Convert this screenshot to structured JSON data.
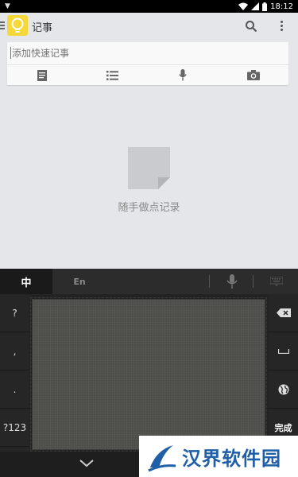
{
  "status_bar": {
    "left_indicator": "▼",
    "time": "18:12",
    "icons": [
      "wifi-icon",
      "signal-icon",
      "battery-icon"
    ]
  },
  "action_bar": {
    "app_title": "记事",
    "icons": [
      "menu-icon",
      "lightbulb-icon",
      "search-icon",
      "overflow-menu-icon"
    ]
  },
  "quick_note": {
    "placeholder": "添加快速记事",
    "buttons": [
      "text-note-icon",
      "checklist-icon",
      "microphone-icon",
      "camera-icon"
    ]
  },
  "empty_state": {
    "icon": "note-page-icon",
    "message": "随手做点记录"
  },
  "keyboard": {
    "tab_chinese": "中",
    "tab_english": "En",
    "left_keys": [
      "?",
      ",",
      ".",
      "?123"
    ],
    "right_keys": [
      "backspace-icon",
      "space-icon",
      "globe-icon",
      "完成"
    ],
    "top_icons": [
      "microphone-icon",
      "keyboard-grid-icon"
    ]
  },
  "nav_bar": {
    "icons": [
      "back-chevron-icon"
    ]
  },
  "watermark": {
    "text": "汉界软件园"
  },
  "colors": {
    "background": "#e4e6e9",
    "card": "#f9f9f9",
    "keyboard": "#232323",
    "accent_yellow": "#f6d838",
    "watermark_blue": "#1f5fa8"
  }
}
